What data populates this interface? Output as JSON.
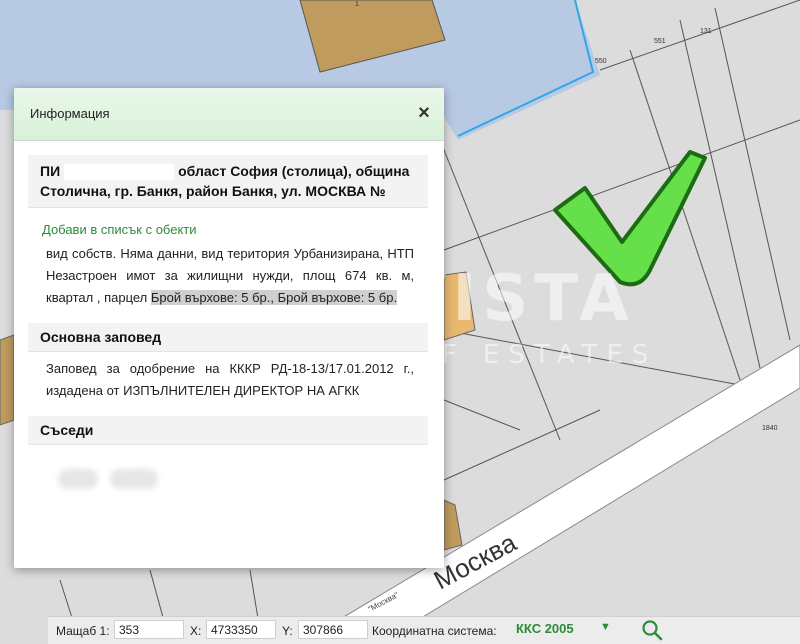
{
  "map": {
    "parcel_numbers": [
      "1",
      "551",
      "131",
      "550",
      "1840"
    ],
    "street_label": "Москва",
    "street_label_small": "\"Москва\"",
    "watermark_main": "PROVISTA",
    "watermark_sub": "THE ART OF ESTATES",
    "colors": {
      "background": "#dcdcdc",
      "blue_parcel": "#b7c9e3",
      "blue_border": "#2fa6e6",
      "building": "#bf9b5d",
      "orange_parcel": "#e7b870",
      "road": "#ffffff",
      "checkmark": "#66e04a"
    }
  },
  "popup": {
    "title": "Информация",
    "close_icon": "close-icon",
    "parcel_header_prefix": "ПИ",
    "parcel_header_rest": "област София (столица), община Столична, гр. Банкя, район Банкя, ул. МОСКВА №",
    "add_link": "Добави в списък с обекти",
    "description_main": "вид собств. Няма данни, вид територия Урбанизирана, НТП Незастроен имот за жилищни нужди, площ 674 кв. м, квартал    , парцел",
    "description_highlight": "Брой върхове: 5 бр., Брой върхове: 5 бр.",
    "section_order_title": "Основна заповед",
    "order_text": "Заповед за одобрение на КККР РД-18-13/17.01.2012 г., издадена от ИЗПЪЛНИТЕЛЕН ДИРЕКТОР НА АГКК",
    "section_neighbors_title": "Съседи"
  },
  "statusbar": {
    "scale_label": "Мащаб 1:",
    "scale_value": "353",
    "x_label": "X:",
    "x_value": "4733350",
    "y_label": "Y:",
    "y_value": "307866",
    "coord_system_label": "Координатна система:",
    "coord_system_value": "ККС 2005",
    "dropdown_icon": "caret-down-icon",
    "search_icon": "search-icon"
  }
}
